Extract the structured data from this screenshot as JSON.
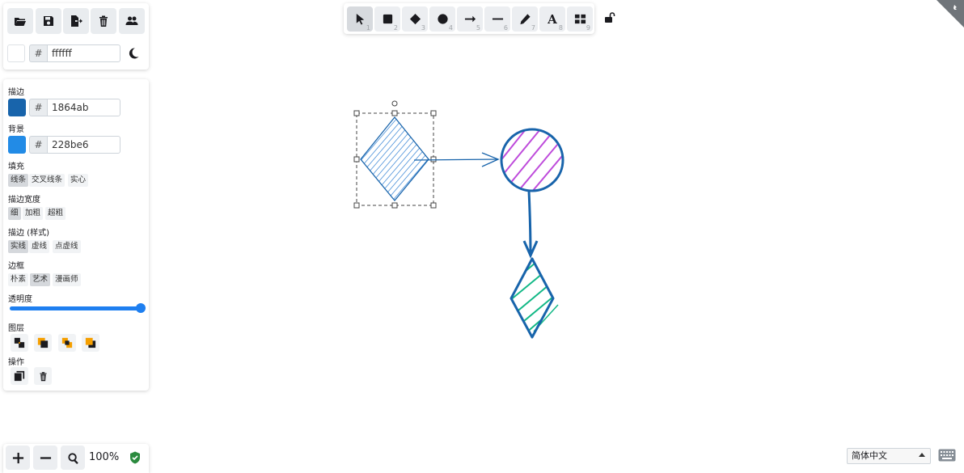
{
  "menu": {
    "buttons": [
      {
        "name": "open-icon"
      },
      {
        "name": "save-icon"
      },
      {
        "name": "export-icon"
      },
      {
        "name": "trash-icon"
      },
      {
        "name": "collab-icon"
      }
    ],
    "background_hash": "#",
    "background_value": "ffffff",
    "background_color": "#ffffff",
    "theme_icon": "moon-icon"
  },
  "props": {
    "stroke_label": "描边",
    "stroke_hash": "#",
    "stroke_value": "1864ab",
    "stroke_color": "#1864ab",
    "bg_label": "背景",
    "bg_hash": "#",
    "bg_value": "228be6",
    "bg_color": "#228be6",
    "fill_label": "填充",
    "fill_options": [
      "线条",
      "交叉线条",
      "实心"
    ],
    "stroke_width_label": "描边宽度",
    "stroke_width_options": [
      "细",
      "加粗",
      "超粗"
    ],
    "stroke_style_label": "描边 (样式)",
    "stroke_style_options": [
      "实线",
      "虚线",
      "点虚线"
    ],
    "sloppiness_label": "边框",
    "sloppiness_options": [
      "朴素",
      "艺术",
      "漫画师"
    ],
    "opacity_label": "透明度",
    "opacity_value": 100,
    "layers_label": "图层",
    "actions_label": "操作"
  },
  "toolbar": {
    "tools": [
      {
        "name": "selection-tool",
        "num": "1"
      },
      {
        "name": "rectangle-tool",
        "num": "2"
      },
      {
        "name": "diamond-tool",
        "num": "3"
      },
      {
        "name": "ellipse-tool",
        "num": "4"
      },
      {
        "name": "arrow-tool",
        "num": "5"
      },
      {
        "name": "line-tool",
        "num": "6"
      },
      {
        "name": "pencil-tool",
        "num": "7"
      },
      {
        "name": "text-tool",
        "num": "8",
        "glyph": "A"
      },
      {
        "name": "library-tool",
        "num": "9"
      }
    ],
    "lock_icon": "unlock-icon"
  },
  "zoom": {
    "plus": "+",
    "minus": "−",
    "value": "100%"
  },
  "language": {
    "selected": "简体中文"
  },
  "colors": {
    "accent": "#1e7ff0",
    "stroke_blue": "#1864ab",
    "circle_fill": "#be4bdb",
    "diamond2_fill": "#12b886",
    "shield": "#2b8a3e"
  }
}
